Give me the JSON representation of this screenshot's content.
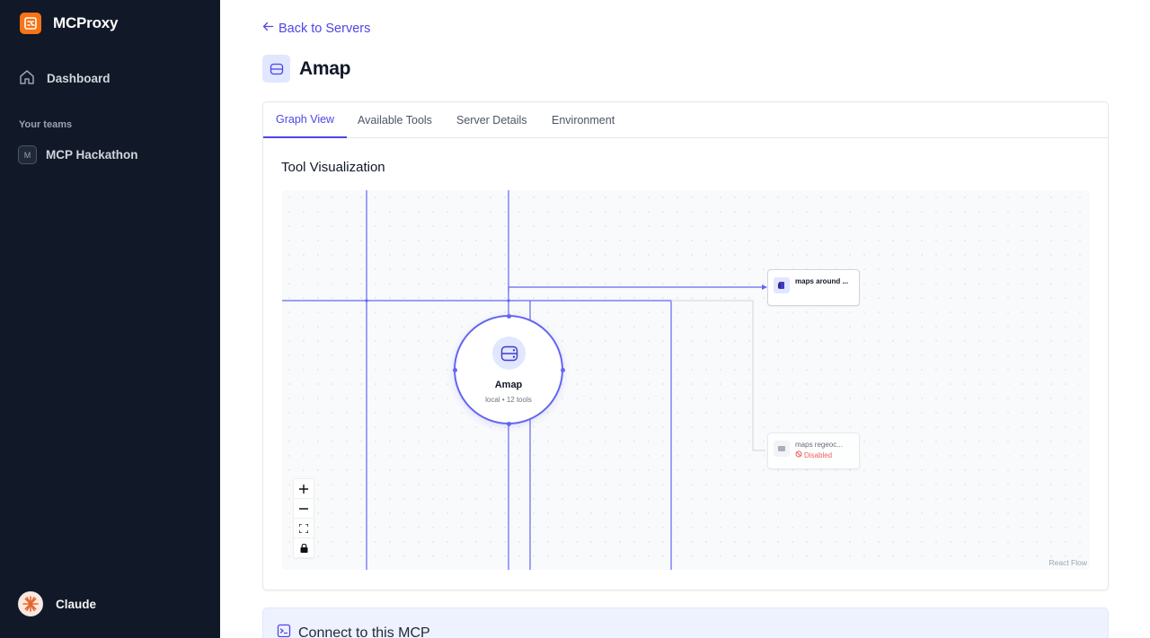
{
  "app": {
    "name": "MCProxy"
  },
  "sidebar": {
    "nav": [
      {
        "label": "Dashboard",
        "icon": "home-icon"
      }
    ],
    "teams_label": "Your teams",
    "teams": [
      {
        "initial": "M",
        "label": "MCP Hackathon"
      }
    ],
    "user": {
      "name": "Claude"
    }
  },
  "main": {
    "back_label": "Back to Servers",
    "server_name": "Amap",
    "tabs": [
      {
        "label": "Graph View",
        "active": true
      },
      {
        "label": "Available Tools",
        "active": false
      },
      {
        "label": "Server Details",
        "active": false
      },
      {
        "label": "Environment",
        "active": false
      }
    ],
    "panel_title": "Tool Visualization",
    "graph": {
      "center": {
        "name": "Amap",
        "subtitle": "local • 12 tools"
      },
      "tools": [
        {
          "name": "maps around ...",
          "status": ""
        },
        {
          "name": "maps regeoc...",
          "status": "Disabled"
        }
      ],
      "attribution": "React Flow"
    },
    "connect_title": "Connect to this MCP"
  },
  "colors": {
    "accent": "#4f46e5",
    "sidebar_bg": "#111827",
    "brand": "#f97316",
    "danger": "#ef4444"
  }
}
